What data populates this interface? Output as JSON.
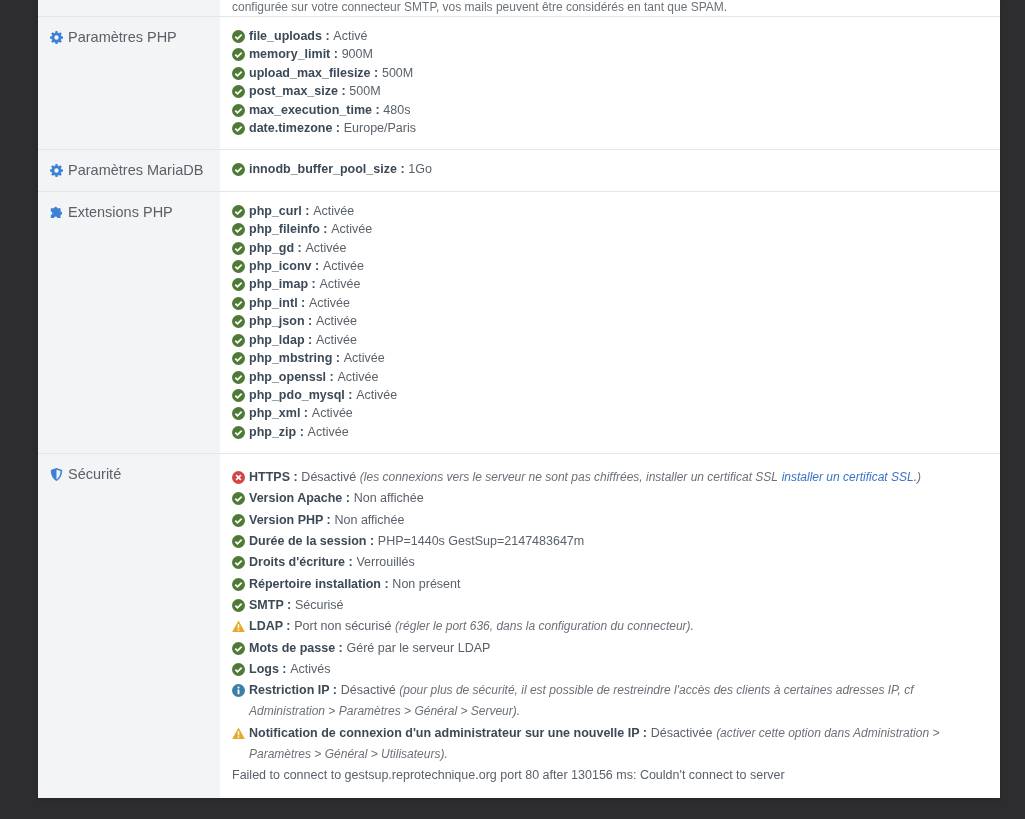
{
  "top_note": "configurée sur votre connecteur SMTP, vos mails peuvent être considérés en tant que SPAM.",
  "sections": [
    {
      "title": "Paramètres PHP",
      "items": [
        {
          "kind": "ok",
          "label": "file_uploads :",
          "value": "Activé"
        },
        {
          "kind": "ok",
          "label": "memory_limit :",
          "value": "900M"
        },
        {
          "kind": "ok",
          "label": "upload_max_filesize :",
          "value": "500M"
        },
        {
          "kind": "ok",
          "label": "post_max_size :",
          "value": "500M"
        },
        {
          "kind": "ok",
          "label": "max_execution_time :",
          "value": "480s"
        },
        {
          "kind": "ok",
          "label": "date.timezone :",
          "value": "Europe/Paris"
        }
      ]
    },
    {
      "title": "Paramètres MariaDB",
      "items": [
        {
          "kind": "ok",
          "label": "innodb_buffer_pool_size :",
          "value": "1Go"
        }
      ]
    },
    {
      "title": "Extensions PHP",
      "items": [
        {
          "kind": "ok",
          "label": "php_curl :",
          "value": "Activée"
        },
        {
          "kind": "ok",
          "label": "php_fileinfo :",
          "value": "Activée"
        },
        {
          "kind": "ok",
          "label": "php_gd :",
          "value": "Activée"
        },
        {
          "kind": "ok",
          "label": "php_iconv :",
          "value": "Activée"
        },
        {
          "kind": "ok",
          "label": "php_imap :",
          "value": "Activée"
        },
        {
          "kind": "ok",
          "label": "php_intl :",
          "value": "Activée"
        },
        {
          "kind": "ok",
          "label": "php_json :",
          "value": "Activée"
        },
        {
          "kind": "ok",
          "label": "php_ldap :",
          "value": "Activée"
        },
        {
          "kind": "ok",
          "label": "php_mbstring :",
          "value": "Activée"
        },
        {
          "kind": "ok",
          "label": "php_openssl :",
          "value": "Activée"
        },
        {
          "kind": "ok",
          "label": "php_pdo_mysql :",
          "value": "Activée"
        },
        {
          "kind": "ok",
          "label": "php_xml :",
          "value": "Activée"
        },
        {
          "kind": "ok",
          "label": "php_zip :",
          "value": "Activée"
        }
      ]
    },
    {
      "title": "Sécurité",
      "items": [
        {
          "kind": "error",
          "label": "HTTPS :",
          "value": "Désactivé",
          "note": "(les connexions vers le serveur ne sont pas chiffrées, installer un certificat SSL",
          "link": "installer un certificat SSL.",
          "note_end": ")"
        },
        {
          "kind": "ok",
          "label": "Version Apache :",
          "value": "Non affichée"
        },
        {
          "kind": "ok",
          "label": "Version PHP :",
          "value": "Non affichée"
        },
        {
          "kind": "ok",
          "label": "Durée de la session :",
          "value": "PHP=1440s GestSup=2147483647m"
        },
        {
          "kind": "ok",
          "label": "Droits d'écriture :",
          "value": "Verrouillés"
        },
        {
          "kind": "ok",
          "label": "Répertoire installation :",
          "value": "Non présent"
        },
        {
          "kind": "ok",
          "label": "SMTP :",
          "value": "Sécurisé"
        },
        {
          "kind": "warning",
          "label": "LDAP :",
          "value": "Port non sécurisé",
          "note": "(régler le port 636, dans la configuration du connecteur)."
        },
        {
          "kind": "ok",
          "label": "Mots de passe :",
          "value": "Géré par le serveur LDAP"
        },
        {
          "kind": "ok",
          "label": "Logs :",
          "value": "Activés"
        },
        {
          "kind": "info",
          "label": "Restriction IP :",
          "value": "Désactivé",
          "note": "(pour plus de sécurité, il est possible de restreindre l'accès des clients à certaines adresses IP, cf Administration > Paramètres > Général > Serveur)."
        },
        {
          "kind": "warning",
          "label": "Notification de connexion d'un administrateur sur une nouvelle IP :",
          "value": "Désactivée",
          "note": "(activer cette option dans Administration > Paramètres > Général > Utilisateurs)."
        }
      ],
      "message": "Failed to connect to gestsup.reprotechnique.org port 80 after 130156 ms: Couldn't connect to server"
    }
  ]
}
